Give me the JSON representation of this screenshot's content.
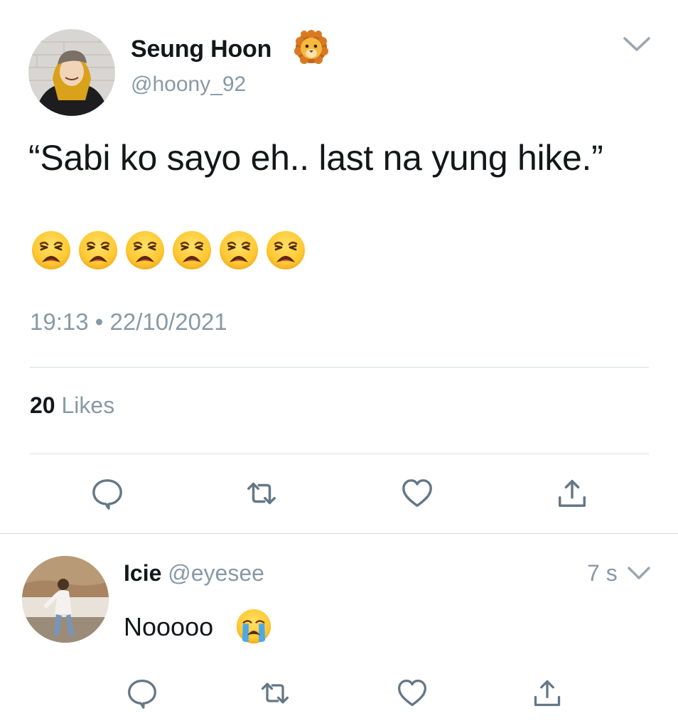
{
  "tweet": {
    "author_name": "Seung Hoon",
    "author_handle": "@hoony_92",
    "name_emoji": "lion-face-icon",
    "text": "“Sabi ko sayo eh.. last na yung hike.”",
    "emojis": [
      "weary-face-icon",
      "weary-face-icon",
      "weary-face-icon",
      "weary-face-icon",
      "weary-face-icon",
      "weary-face-icon"
    ],
    "time": "19:13",
    "separator": "•",
    "date": "22/10/2021",
    "likes_count": "20",
    "likes_label": "Likes",
    "actions": [
      "reply-icon",
      "retweet-icon",
      "like-icon",
      "share-icon"
    ]
  },
  "reply": {
    "author_name": "Icie",
    "author_handle": "@eyesee",
    "age": "7 s",
    "text": "Nooooo",
    "text_emoji": "loudly-crying-face-icon",
    "actions": [
      "reply-icon",
      "retweet-icon",
      "like-icon",
      "share-icon"
    ]
  },
  "colors": {
    "primary_text": "#14171a",
    "secondary_text": "#8899a6",
    "divider": "#d6dbe0",
    "icon_gray": "#657786"
  }
}
